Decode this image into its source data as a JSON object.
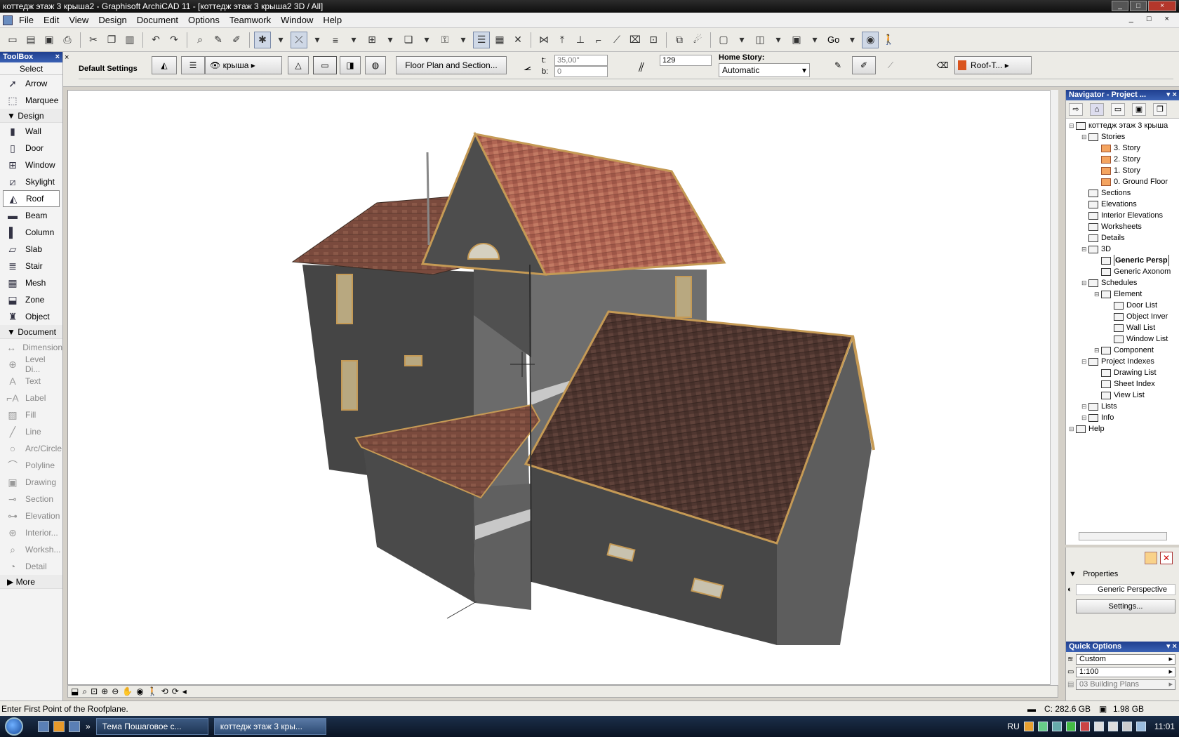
{
  "window": {
    "title": "коттедж этаж 3 крыша2 - Graphisoft ArchiCAD 11 - [коттедж этаж 3 крыша2 3D / All]"
  },
  "menu": [
    "File",
    "Edit",
    "View",
    "Design",
    "Document",
    "Options",
    "Teamwork",
    "Window",
    "Help"
  ],
  "toolbar": {
    "go_label": "Go"
  },
  "toolbox": {
    "title": "ToolBox",
    "select_label": "Select",
    "select_tools": [
      "Arrow",
      "Marquee"
    ],
    "design_label": "Design",
    "design_tools": [
      "Wall",
      "Door",
      "Window",
      "Skylight",
      "Roof",
      "Beam",
      "Column",
      "Slab",
      "Stair",
      "Mesh",
      "Zone",
      "Object"
    ],
    "document_label": "Document",
    "document_tools": [
      "Dimension",
      "Level Di...",
      "Text",
      "Label",
      "Fill",
      "Line",
      "Arc/Circle",
      "Polyline",
      "Drawing",
      "Section",
      "Elevation",
      "Interior...",
      "Worksh...",
      "Detail"
    ],
    "more_label": "More",
    "selected_tool": "Roof"
  },
  "infobox": {
    "title": "Default Settings",
    "layer": "крыша",
    "floor_plan_button": "Floor Plan and Section...",
    "angle_label": "t:",
    "angle_value": "35,00°",
    "b_label": "b:",
    "b_value": "0",
    "thickness_value": "129",
    "home_story_label": "Home Story:",
    "home_story_value": "Automatic",
    "material_label": "Roof-T..."
  },
  "navigator": {
    "title": "Navigator - Project ...",
    "tree": [
      {
        "level": 0,
        "label": "коттедж этаж 3 крыша",
        "icon": "project"
      },
      {
        "level": 1,
        "label": "Stories",
        "icon": "folder"
      },
      {
        "level": 2,
        "label": "3. Story",
        "icon": "story"
      },
      {
        "level": 2,
        "label": "2. Story",
        "icon": "story"
      },
      {
        "level": 2,
        "label": "1. Story",
        "icon": "story"
      },
      {
        "level": 2,
        "label": "0. Ground Floor",
        "icon": "story"
      },
      {
        "level": 1,
        "label": "Sections",
        "icon": "view"
      },
      {
        "level": 1,
        "label": "Elevations",
        "icon": "view"
      },
      {
        "level": 1,
        "label": "Interior Elevations",
        "icon": "view"
      },
      {
        "level": 1,
        "label": "Worksheets",
        "icon": "view"
      },
      {
        "level": 1,
        "label": "Details",
        "icon": "view"
      },
      {
        "level": 1,
        "label": "3D",
        "icon": "view"
      },
      {
        "level": 2,
        "label": "Generic Persp",
        "icon": "camera",
        "selected": true
      },
      {
        "level": 2,
        "label": "Generic Axonom",
        "icon": "box"
      },
      {
        "level": 1,
        "label": "Schedules",
        "icon": "schedule"
      },
      {
        "level": 2,
        "label": "Element",
        "icon": "schedule"
      },
      {
        "level": 3,
        "label": "Door List",
        "icon": "list"
      },
      {
        "level": 3,
        "label": "Object Inver",
        "icon": "list"
      },
      {
        "level": 3,
        "label": "Wall List",
        "icon": "list"
      },
      {
        "level": 3,
        "label": "Window List",
        "icon": "list"
      },
      {
        "level": 2,
        "label": "Component",
        "icon": "schedule"
      },
      {
        "level": 1,
        "label": "Project Indexes",
        "icon": "view"
      },
      {
        "level": 2,
        "label": "Drawing List",
        "icon": "list"
      },
      {
        "level": 2,
        "label": "Sheet Index",
        "icon": "list"
      },
      {
        "level": 2,
        "label": "View List",
        "icon": "list"
      },
      {
        "level": 1,
        "label": "Lists",
        "icon": "view"
      },
      {
        "level": 1,
        "label": "Info",
        "icon": "view"
      },
      {
        "level": 0,
        "label": "Help",
        "icon": "view"
      }
    ]
  },
  "properties": {
    "label": "Properties",
    "view_name": "Generic Perspective",
    "settings_button": "Settings..."
  },
  "quick_options": {
    "title": "Quick Options",
    "rows": [
      "Custom",
      "1:100",
      "03 Building Plans"
    ]
  },
  "status": {
    "prompt": "Enter First Point of the Roofplane.",
    "disk": "C: 282.6 GB",
    "memory": "1.98 GB"
  },
  "taskbar": {
    "tasks": [
      "Тема Пошаговое с...",
      "коттедж этаж 3 кры..."
    ],
    "language": "RU",
    "clock": "11:01"
  },
  "colors": {
    "roof_front": "#a8614e",
    "roof_back": "#5a3a30",
    "wall": "#4b4b4b",
    "wall_light": "#6a6a6a",
    "trim": "#c59a55"
  }
}
